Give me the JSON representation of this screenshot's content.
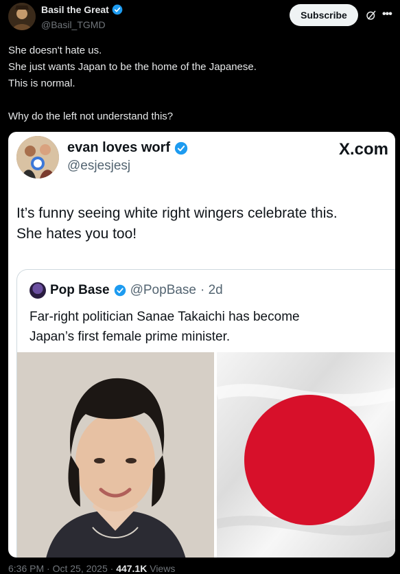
{
  "author": {
    "name": "Basil the Great",
    "handle": "@Basil_TGMD",
    "verified": true
  },
  "actions": {
    "subscribe_label": "Subscribe"
  },
  "post": {
    "lines": [
      "She doesn't hate us.",
      "She just wants Japan to be the home of the Japanese.",
      "This is normal.",
      "",
      "Why do the left not understand this?"
    ]
  },
  "embedded": {
    "author_name": "evan loves worf",
    "author_handle": "@esjesjesj",
    "source": "X.com",
    "text_line1": "It’s funny seeing white right wingers celebrate this.",
    "text_line2": "She hates you too!",
    "quoted": {
      "author_name": "Pop Base",
      "author_handle": "@PopBase",
      "time": "· 2d",
      "text_line1": "Far-right politician Sanae Takaichi has become",
      "text_line2": "Japan’s first female prime minister."
    }
  },
  "meta": {
    "time": "6:36 PM · Oct 25, 2025 ·",
    "views_count": "447.1K",
    "views_label": "Views"
  },
  "colors": {
    "background": "#000000",
    "verified_blue": "#1d9bf0",
    "flag_red": "#d7102a"
  }
}
